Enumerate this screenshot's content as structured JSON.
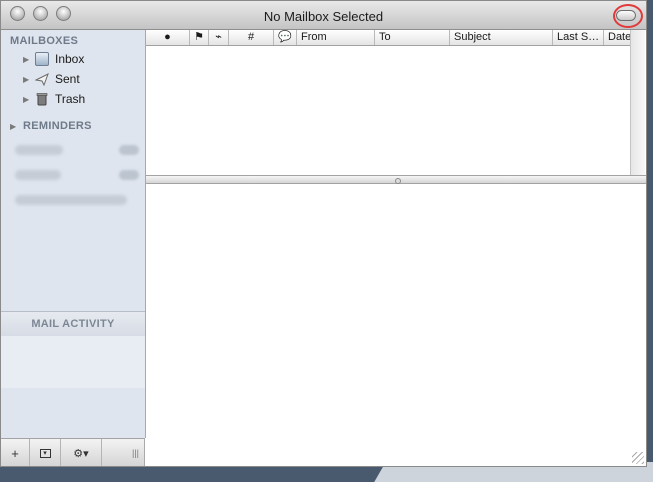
{
  "window": {
    "title": "No Mailbox Selected"
  },
  "sidebar": {
    "mailboxes_header": "MAILBOXES",
    "items": [
      {
        "label": "Inbox",
        "icon": "inbox-icon"
      },
      {
        "label": "Sent",
        "icon": "sent-icon"
      },
      {
        "label": "Trash",
        "icon": "trash-icon"
      }
    ],
    "reminders_header": "REMINDERS",
    "mail_activity_header": "MAIL ACTIVITY"
  },
  "message_list": {
    "columns": [
      "●",
      "⚑",
      "⌁",
      "#",
      "💬",
      "From",
      "To",
      "Subject",
      "Last S…",
      "Date"
    ]
  },
  "bottom_bar": {
    "add_label": "+",
    "show_label": "▾",
    "action_label": "⚙▾",
    "grip_label": "|||"
  },
  "colors": {
    "accent": "#e03a3a",
    "sidebar_bg": "#dfe5ee"
  }
}
